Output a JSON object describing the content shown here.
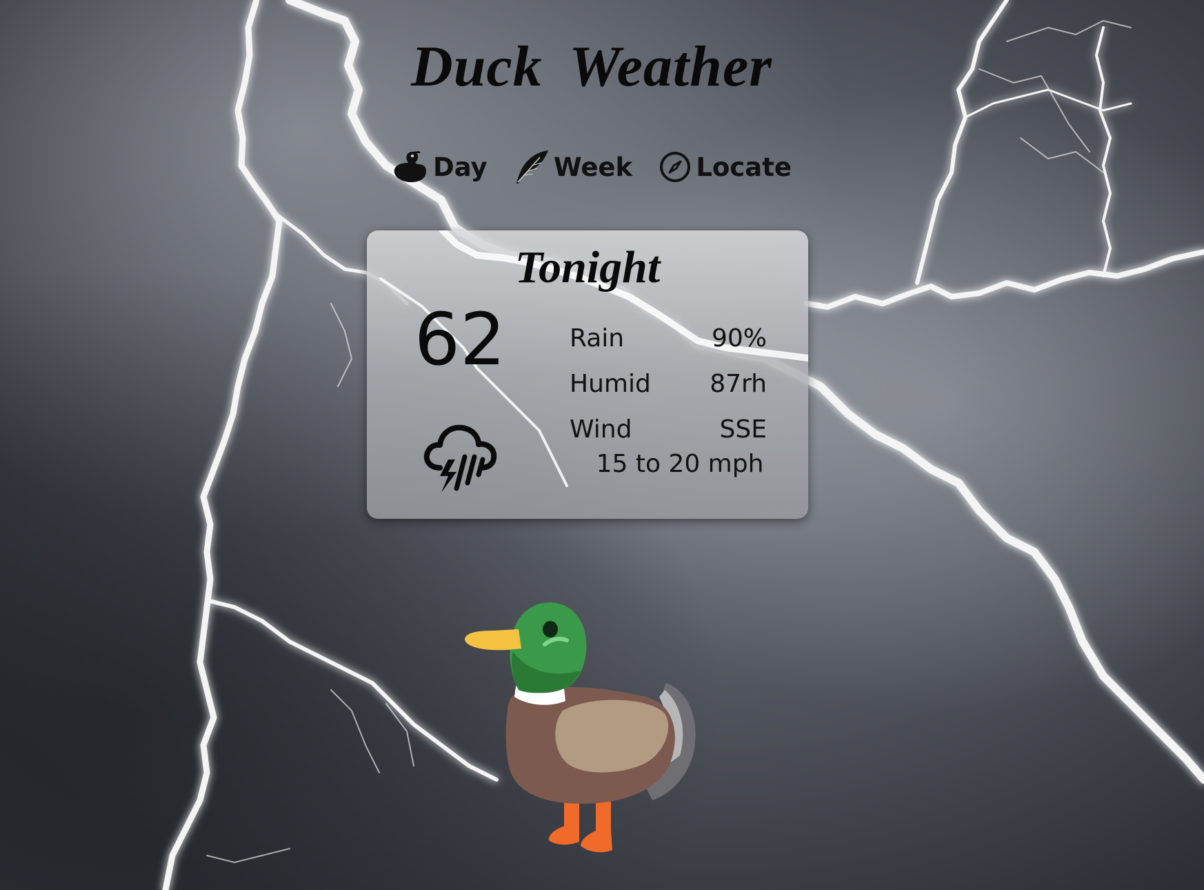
{
  "app": {
    "title": "Duck Weather"
  },
  "nav": {
    "items": [
      {
        "label": "Day",
        "icon": "duck-icon"
      },
      {
        "label": "Week",
        "icon": "feather-icon"
      },
      {
        "label": "Locate",
        "icon": "compass-icon"
      }
    ]
  },
  "forecast": {
    "period": "Tonight",
    "temperature": "62",
    "condition_icon": "thunderstorm-rain-icon",
    "stats": [
      {
        "label": "Rain",
        "value": "90%"
      },
      {
        "label": "Humid",
        "value": "87rh"
      },
      {
        "label": "Wind",
        "value": "SSE"
      }
    ],
    "wind_speed": "15 to 20 mph"
  },
  "mascot": {
    "icon": "mallard-duck-illustration"
  },
  "colors": {
    "background": "#3a3d44",
    "lightning": "#f2f2f2",
    "card": "#b4b6ba",
    "text": "#0a0a0a",
    "duck_head": "#3a9a4a",
    "duck_bill": "#f5c242",
    "duck_body": "#7d5a4f",
    "duck_wing": "#b39a83",
    "duck_feet": "#f06a2a"
  }
}
